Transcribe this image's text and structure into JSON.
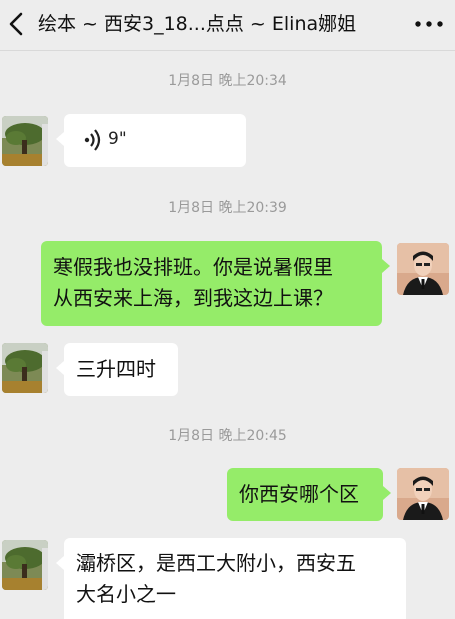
{
  "header": {
    "title": "绘本 ~ 西安3_18...点点 ~ Elina娜姐",
    "back_icon": "chevron-left-icon",
    "more_icon": "more-dots-icon"
  },
  "messages": [
    {
      "type": "time",
      "text": "1月8日 晚上20:34"
    },
    {
      "type": "voice",
      "side": "left",
      "duration": "9\""
    },
    {
      "type": "time",
      "text": "1月8日 晚上20:39"
    },
    {
      "type": "text",
      "side": "right",
      "lines": [
        "寒假我也没排班。你是说暑假里",
        "从西安来上海，到我这边上课？"
      ]
    },
    {
      "type": "text",
      "side": "left",
      "lines": [
        "三升四时"
      ]
    },
    {
      "type": "time",
      "text": "1月8日 晚上20:45"
    },
    {
      "type": "text",
      "side": "right",
      "lines": [
        "你西安哪个区"
      ]
    },
    {
      "type": "text",
      "side": "left",
      "lines": [
        "灞桥区，是西工大附小，西安五",
        "大名小之一"
      ]
    }
  ],
  "colors": {
    "background": "#ededed",
    "bubble_self": "#95ec69",
    "bubble_other": "#ffffff"
  }
}
